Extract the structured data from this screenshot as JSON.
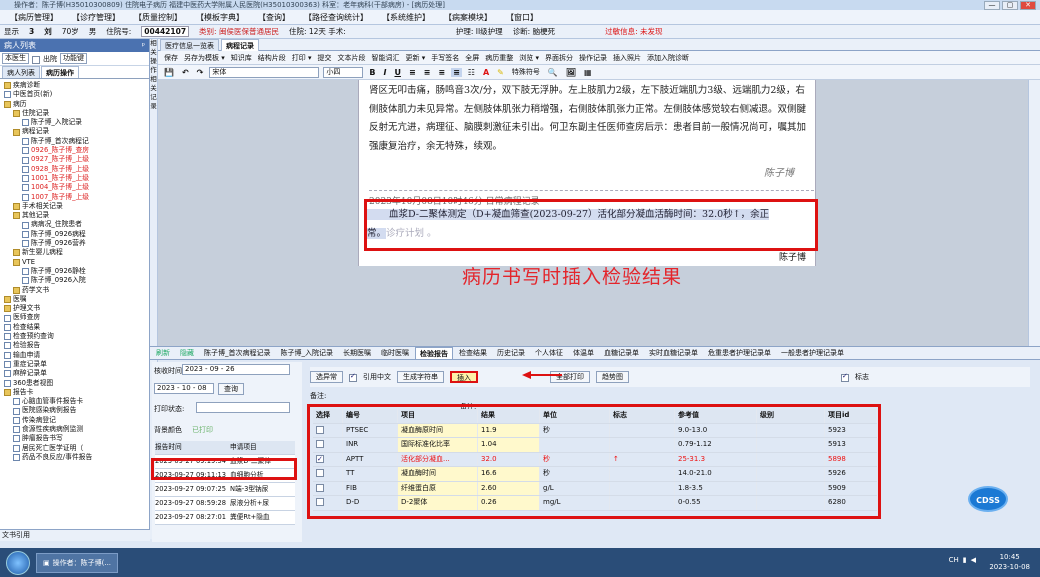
{
  "window": {
    "title": "操作者：陈子博(H35010300809) 住院电子病历 福建中医药大学附属人民医院(H35010300363) 科室：老年病科(干部病房) - [病历处理]",
    "min": "—",
    "max": "▢",
    "close": "✕"
  },
  "menu": [
    "【病历管理】",
    "【诊疗管理】",
    "【质量控制】",
    "【模板字典】",
    "【查询】",
    "【路径查询统计】",
    "【系统维护】",
    "【病案模块】",
    "【窗口】"
  ],
  "patient": {
    "show": "显示",
    "bed": "3",
    "name": "刘",
    "age": "70岁",
    "sex": "男",
    "admit_label": "住院号:",
    "admit_no": "00442107",
    "cat": "类别: 闽侯医保普通居民",
    "stay": "住院: 12天  手术:",
    "nursing": "护理: II级护理",
    "diagnosis": "诊断: 脑梗死",
    "allergy": "过敏信息: 未发现"
  },
  "left": {
    "header": "病人列表",
    "pin": "ᵖ",
    "unit": "本医生",
    "discharged": "出院",
    "func": "功能键",
    "tab1": "病人列表",
    "tab2": "病历操作",
    "tree": [
      {
        "t": "疾病诊断",
        "d": 0,
        "f": 1
      },
      {
        "t": "中医首页(新)",
        "d": 0,
        "f": 0
      },
      {
        "t": "病历",
        "d": 0,
        "f": 1
      },
      {
        "t": "住院记录",
        "d": 1,
        "f": 1
      },
      {
        "t": "陈子博_入院记录",
        "d": 2,
        "f": 0
      },
      {
        "t": "病程记录",
        "d": 1,
        "f": 1
      },
      {
        "t": "陈子博_首次病程记",
        "d": 2,
        "f": 0
      },
      {
        "t": "0926_陈子博_查房",
        "d": 2,
        "f": 0,
        "r": 1
      },
      {
        "t": "0927_陈子博_上级",
        "d": 2,
        "f": 0,
        "r": 1
      },
      {
        "t": "0928_陈子博_上级",
        "d": 2,
        "f": 0,
        "r": 1
      },
      {
        "t": "1001_陈子博_上级",
        "d": 2,
        "f": 0,
        "r": 1
      },
      {
        "t": "1004_陈子博_上级",
        "d": 2,
        "f": 0,
        "r": 1
      },
      {
        "t": "1007_陈子博_上级",
        "d": 2,
        "f": 0,
        "r": 1
      },
      {
        "t": "手术相关记录",
        "d": 1,
        "f": 1
      },
      {
        "t": "其他记录",
        "d": 1,
        "f": 1
      },
      {
        "t": "病病况_住院患者",
        "d": 2,
        "f": 0
      },
      {
        "t": "陈子博_0926病程",
        "d": 2,
        "f": 0
      },
      {
        "t": "陈子博_0926营养",
        "d": 2,
        "f": 0
      },
      {
        "t": "新生婴儿病程",
        "d": 1,
        "f": 1
      },
      {
        "t": "VTE",
        "d": 1,
        "f": 1
      },
      {
        "t": "陈子博_0926静栓",
        "d": 2,
        "f": 0
      },
      {
        "t": "陈子博_0926入院",
        "d": 2,
        "f": 0
      },
      {
        "t": "药学文书",
        "d": 1,
        "f": 1
      },
      {
        "t": "医嘱",
        "d": 0,
        "f": 1
      },
      {
        "t": "护理文书",
        "d": 0,
        "f": 1
      },
      {
        "t": "医师查房",
        "d": 0,
        "f": 0
      },
      {
        "t": "检查结果",
        "d": 0,
        "f": 0
      },
      {
        "t": "检查预约查询",
        "d": 0,
        "f": 0
      },
      {
        "t": "检验报告",
        "d": 0,
        "f": 0
      },
      {
        "t": "输血申请",
        "d": 0,
        "f": 0
      },
      {
        "t": "重症记录单",
        "d": 0,
        "f": 0
      },
      {
        "t": "麻醉记录单",
        "d": 0,
        "f": 0
      },
      {
        "t": "360患者视图",
        "d": 0,
        "f": 0
      },
      {
        "t": "报告卡",
        "d": 0,
        "f": 1
      },
      {
        "t": "心脑血管事件报告卡",
        "d": 1,
        "f": 0
      },
      {
        "t": "医院感染病例报告",
        "d": 1,
        "f": 0
      },
      {
        "t": "传染病登记",
        "d": 1,
        "f": 0
      },
      {
        "t": "食源性疾病病例监测",
        "d": 1,
        "f": 0
      },
      {
        "t": "肿瘤报告书写",
        "d": 1,
        "f": 0
      },
      {
        "t": "居民死亡医学证明（",
        "d": 1,
        "f": 0
      },
      {
        "t": "药品不良反应/事件报告",
        "d": 1,
        "f": 0
      }
    ],
    "bottom": "文书引用"
  },
  "vstrip": "相关操作 相关记录",
  "doctabs": [
    "医疗信息一览表",
    "病程记录"
  ],
  "toolbar1": [
    "保存",
    "另存为模板 ▾",
    "知识库",
    "结构片段",
    "打印 ▾",
    "提交",
    "文本片段",
    "智能词汇",
    "更新 ▾",
    "手写签名",
    "全屏",
    "病历重整",
    "浏览 ▾",
    "界面拆分",
    "操作记录",
    "插入照片",
    "添加入院诊断"
  ],
  "toolbar2": {
    "font": "宋体",
    "size": "小四",
    "b": "B",
    "i": "I",
    "u": "U",
    "extra": "特殊符号"
  },
  "doc": {
    "para": "肾区无叩击痛，肠鸣音3次/分，双下肢无浮肿。左上肢肌力2级，左下肢近端肌力3级、远端肌力2级，右侧肢体肌力未见异常。左侧肢体肌张力稍增强，右侧肢体肌张力正常。左侧肢体感觉较右侧减退。双侧腱反射无亢进，病理征、脑膜刺激征未引出。何卫东副主任医师查房后示：患者目前一般情况尚可，嘱其加强康复治疗，余无特殊，续观。",
    "sign1": "陈子博",
    "rec2_header": "2023年10月08日10时46分       日常病程记录",
    "hl1": "血浆D-二聚体测定（D+凝血筛查(2023-09-27）活化部分凝血活酶时间：32.0秒↑，余正",
    "hl2": "常。",
    "hl2_rest": "诊疗计划 。",
    "sign2": "陈子博",
    "caption": "病历书写时插入检验结果"
  },
  "btabs": [
    "刷新",
    "隐藏",
    "陈子博_首次病程记录",
    "陈子博_入院记录",
    "长期医嘱",
    "临时医嘱",
    "检验报告",
    "检查结果",
    "历史记录",
    "个人体征",
    "体温单",
    "血糖记录单",
    "实时血糖记录单",
    "危重患者护理记录单",
    "一般患者护理记录单"
  ],
  "filters": {
    "time_label": "核收时间:",
    "from": "2023 - 09 - 26",
    "to": "2023 - 10 - 08",
    "query": "查询",
    "print_label": "打印状态:",
    "bg_label": "背景颜色",
    "bg_value": "已打印",
    "col_time": "报告时间",
    "col_item": "申请项目",
    "rows": [
      [
        "2023-09-27 09:19:54",
        "血浆D-二聚体"
      ],
      [
        "2023-09-27 09:11:13",
        "血细胞分析"
      ],
      [
        "2023-09-27 09:07:25",
        "N端-3型钠尿"
      ],
      [
        "2023-09-27 08:59:28",
        "尿液分析+尿"
      ],
      [
        "2023-09-27 08:27:01",
        "粪便Rt+隐血"
      ]
    ]
  },
  "labtop": {
    "mode": "选异常",
    "quote": "引用中文",
    "gen": "生成字符串",
    "insert": "插入",
    "printall": "全部打印",
    "trend": "趋势图",
    "flag": "标志",
    "notes1": "备注:",
    "notes2": "备注:"
  },
  "lab": {
    "headers": [
      "选择",
      "编号",
      "项目",
      "结果",
      "单位",
      "标志",
      "参考值",
      "级别",
      "项目id"
    ],
    "rows": [
      {
        "sel": 0,
        "code": "PTSEC",
        "item": "凝血酶原时间",
        "result": "11.9",
        "unit": "秒",
        "flag": "",
        "ref": "9.0-13.0",
        "level": "",
        "id": "5923"
      },
      {
        "sel": 0,
        "code": "INR",
        "item": "国际标准化比率",
        "result": "1.04",
        "unit": "",
        "flag": "",
        "ref": "0.79-1.12",
        "level": "",
        "id": "5913"
      },
      {
        "sel": 1,
        "code": "APTT",
        "item": "活化部分凝血...",
        "result": "32.0",
        "unit": "秒",
        "flag": "↑",
        "ref": "25-31.3",
        "level": "",
        "id": "5898",
        "abn": 1
      },
      {
        "sel": 0,
        "code": "TT",
        "item": "凝血酶时间",
        "result": "16.6",
        "unit": "秒",
        "flag": "",
        "ref": "14.0-21.0",
        "level": "",
        "id": "5926"
      },
      {
        "sel": 0,
        "code": "FIB",
        "item": "纤维蛋白原",
        "result": "2.60",
        "unit": "g/L",
        "flag": "",
        "ref": "1.8-3.5",
        "level": "",
        "id": "5909"
      },
      {
        "sel": 0,
        "code": "D-D",
        "item": "D-2聚体",
        "result": "0.26",
        "unit": "mg/L",
        "flag": "",
        "ref": "0-0.55",
        "level": "",
        "id": "6280"
      }
    ]
  },
  "cdss": "CDSS",
  "taskbar": {
    "item": "操作者：陈子博(...",
    "time": "10:45",
    "date": "2023-10-08",
    "tray": "CH"
  },
  "colors": {
    "red": "#d11",
    "accent": "#4b72b0"
  }
}
